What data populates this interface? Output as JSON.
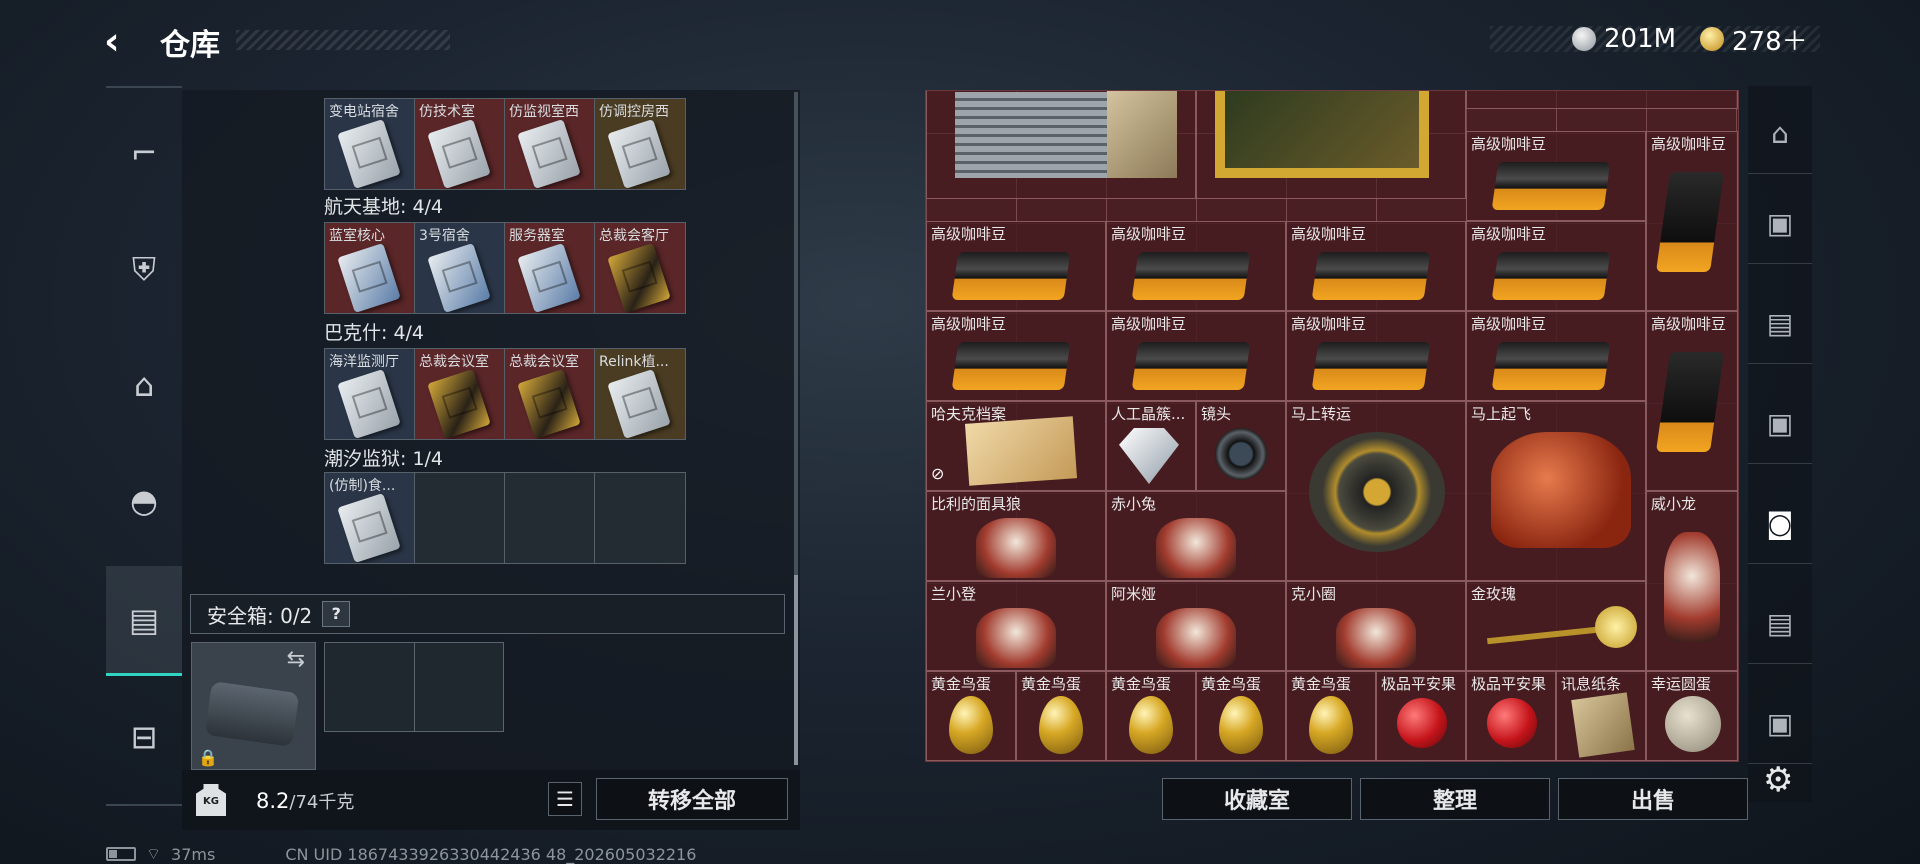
{
  "header": {
    "back_icon": "‹",
    "title": "仓库",
    "currency_silver": "201M",
    "currency_gold": "278＋",
    "colors": {
      "silver": "#c9cdd2",
      "gold": "#d7a825"
    }
  },
  "left_nav": {
    "items": [
      {
        "icon": "pistol-icon",
        "glyph": "⌐"
      },
      {
        "icon": "vest-icon",
        "glyph": "⛨"
      },
      {
        "icon": "backpack-icon",
        "glyph": "⌂"
      },
      {
        "icon": "helmet-icon",
        "glyph": "◓"
      },
      {
        "icon": "case-icon",
        "glyph": "▤"
      },
      {
        "icon": "toolbox-icon",
        "glyph": "⊟"
      }
    ],
    "active_index": 4
  },
  "key_rows": [
    {
      "section": "",
      "cards": [
        {
          "label": "变电站宿舍",
          "tone": "blue",
          "key": "w"
        },
        {
          "label": "仿技术室",
          "tone": "red",
          "key": "w"
        },
        {
          "label": "仿监视室西",
          "tone": "red",
          "key": "w"
        },
        {
          "label": "仿调控房西",
          "tone": "gold",
          "key": "w"
        }
      ]
    },
    {
      "section": "航天基地: 4/4",
      "cards": [
        {
          "label": "蓝室核心",
          "tone": "red",
          "key": "b"
        },
        {
          "label": "3号宿舍",
          "tone": "blue",
          "key": "b"
        },
        {
          "label": "服务器室",
          "tone": "red",
          "key": "b"
        },
        {
          "label": "总裁会客厅",
          "tone": "red",
          "key": "g"
        }
      ]
    },
    {
      "section": "巴克什: 4/4",
      "cards": [
        {
          "label": "海洋监测厅",
          "tone": "blue",
          "key": "w"
        },
        {
          "label": "总裁会议室",
          "tone": "red",
          "key": "g"
        },
        {
          "label": "总裁会议室",
          "tone": "red",
          "key": "g"
        },
        {
          "label": "Relink植...",
          "tone": "gold",
          "key": "w"
        }
      ]
    },
    {
      "section": "潮汐监狱: 1/4",
      "cards": [
        {
          "label": "(仿制)食...",
          "tone": "blue",
          "key": "w"
        },
        {
          "label": "",
          "tone": "empty",
          "key": ""
        },
        {
          "label": "",
          "tone": "empty",
          "key": ""
        },
        {
          "label": "",
          "tone": "empty",
          "key": ""
        }
      ]
    }
  ],
  "safebox": {
    "label": "安全箱: 0/2",
    "help": "?",
    "swap_icon": "⇆",
    "lock_icon": "🔒"
  },
  "footer_left": {
    "kg_label": "KG",
    "weight_current": "8.2",
    "weight_max": "/74千克",
    "list_icon": "☰",
    "transfer_all": "转移全部"
  },
  "stash_items": [
    {
      "label": "高级咖啡豆",
      "type": "coffee"
    },
    {
      "label": "高级咖啡豆",
      "type": "coffee-tall"
    },
    {
      "label": "高级咖啡豆",
      "type": "coffee"
    },
    {
      "label": "高级咖啡豆",
      "type": "coffee"
    },
    {
      "label": "高级咖啡豆",
      "type": "coffee"
    },
    {
      "label": "高级咖啡豆",
      "type": "coffee"
    },
    {
      "label": "高级咖啡豆",
      "type": "coffee"
    },
    {
      "label": "高级咖啡豆",
      "type": "coffee"
    },
    {
      "label": "高级咖啡豆",
      "type": "coffee"
    },
    {
      "label": "高级咖啡豆",
      "type": "coffee"
    },
    {
      "label": "高级咖啡豆",
      "type": "coffee-tall"
    },
    {
      "label": "哈夫克档案",
      "type": "folder"
    },
    {
      "label": "人工晶簇...",
      "type": "crystal"
    },
    {
      "label": "镜头",
      "type": "lens"
    },
    {
      "label": "马上转运",
      "type": "wheel"
    },
    {
      "label": "马上起飞",
      "type": "horse"
    },
    {
      "label": "比利的面具狼",
      "type": "fig"
    },
    {
      "label": "赤小兔",
      "type": "fig"
    },
    {
      "label": "威小龙",
      "type": "fig-tall"
    },
    {
      "label": "兰小登",
      "type": "fig"
    },
    {
      "label": "阿米娅",
      "type": "fig"
    },
    {
      "label": "克小圈",
      "type": "fig"
    },
    {
      "label": "金玫瑰",
      "type": "rose"
    },
    {
      "label": "黄金鸟蛋",
      "type": "egg"
    },
    {
      "label": "黄金鸟蛋",
      "type": "egg"
    },
    {
      "label": "黄金鸟蛋",
      "type": "egg"
    },
    {
      "label": "黄金鸟蛋",
      "type": "egg"
    },
    {
      "label": "黄金鸟蛋",
      "type": "egg"
    },
    {
      "label": "极品平安果",
      "type": "apple"
    },
    {
      "label": "极品平安果",
      "type": "apple"
    },
    {
      "label": "讯息纸条",
      "type": "note"
    },
    {
      "label": "幸运圆蛋",
      "type": "orb"
    }
  ],
  "footer_right": {
    "collection": "收藏室",
    "sort": "整理",
    "sell": "出售",
    "settings_icon": "⚙"
  },
  "right_sidebar": {
    "tabs": [
      "home-icon",
      "stash-tab-1-icon",
      "stash-tab-2-icon",
      "stash-tab-3-icon",
      "stash-tab-4-icon",
      "stash-tab-5-icon",
      "stash-tab-6-icon"
    ],
    "active_index": 4
  },
  "status_bar": {
    "ping": "37ms",
    "uid": "CN UID 1867433926330442436 48_202605032216"
  }
}
